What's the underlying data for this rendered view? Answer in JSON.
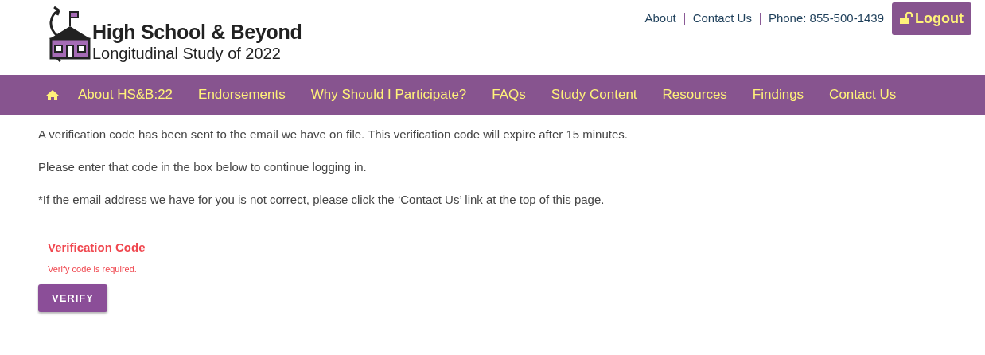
{
  "logo": {
    "title": "High School & Beyond",
    "subtitle": "Longitudinal Study of 2022"
  },
  "top_links": [
    {
      "label": "About"
    },
    {
      "label": "Contact Us"
    }
  ],
  "phone": "Phone: 855-500-1439",
  "logout_button": "Logout",
  "nav": {
    "items": [
      {
        "label": "About HS&B:22"
      },
      {
        "label": "Endorsements"
      },
      {
        "label": "Why Should I Participate?"
      },
      {
        "label": "FAQs"
      },
      {
        "label": "Study Content"
      },
      {
        "label": "Resources"
      },
      {
        "label": "Findings"
      },
      {
        "label": "Contact Us"
      }
    ]
  },
  "messages": [
    "A verification code has been sent to the email we have on file. This verification code will expire after 15 minutes.",
    "Please enter that code in the box below to continue logging in.",
    "*If the email address we have for you is not correct, please click the ‘Contact Us’ link at the top of this page."
  ],
  "verification_field": {
    "label": "Verification Code",
    "error": "Verify code is required.",
    "invalid": true
  },
  "verify_button": "VERIFY"
}
